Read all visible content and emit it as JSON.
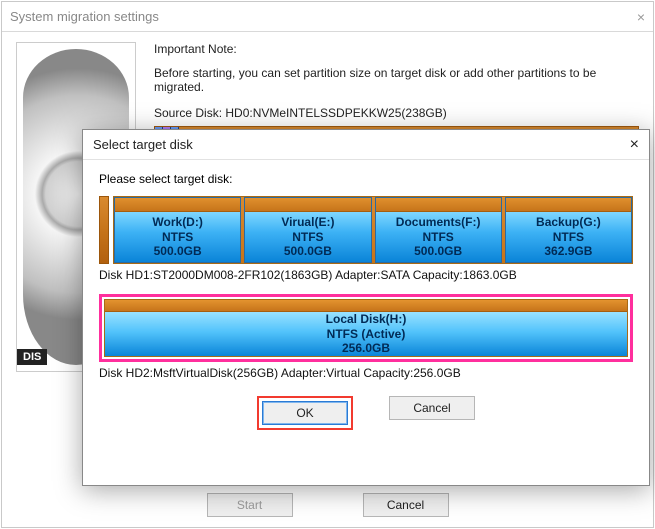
{
  "main_window": {
    "title": "System migration settings",
    "important_note_title": "Important Note:",
    "important_note_text": "Before starting, you can set partition size on target disk or add other partitions to be migrated.",
    "source_disk_label": "Source Disk:  HD0:NVMeINTELSSDPEKKW25(238GB)",
    "hdd_label": "DIS",
    "start_label": "Start",
    "cancel_label": "Cancel"
  },
  "dialog": {
    "title": "Select target disk",
    "prompt": "Please select target disk:",
    "disks": [
      {
        "info": "Disk HD1:ST2000DM008-2FR102(1863GB)  Adapter:SATA  Capacity:1863.0GB",
        "partitions": [
          {
            "name": "Work(D:)",
            "fs": "NTFS",
            "size": "500.0GB"
          },
          {
            "name": "Virual(E:)",
            "fs": "NTFS",
            "size": "500.0GB"
          },
          {
            "name": "Documents(F:)",
            "fs": "NTFS",
            "size": "500.0GB"
          },
          {
            "name": "Backup(G:)",
            "fs": "NTFS",
            "size": "362.9GB"
          }
        ]
      },
      {
        "info": "Disk HD2:MsftVirtualDisk(256GB)  Adapter:Virtual  Capacity:256.0GB",
        "selected": true,
        "partitions": [
          {
            "name": "Local Disk(H:)",
            "fs": "NTFS (Active)",
            "size": "256.0GB"
          }
        ]
      }
    ],
    "ok_label": "OK",
    "cancel_label": "Cancel"
  },
  "colors": {
    "highlight": "#ff2f9d",
    "ok_outline": "#f23a2f"
  }
}
